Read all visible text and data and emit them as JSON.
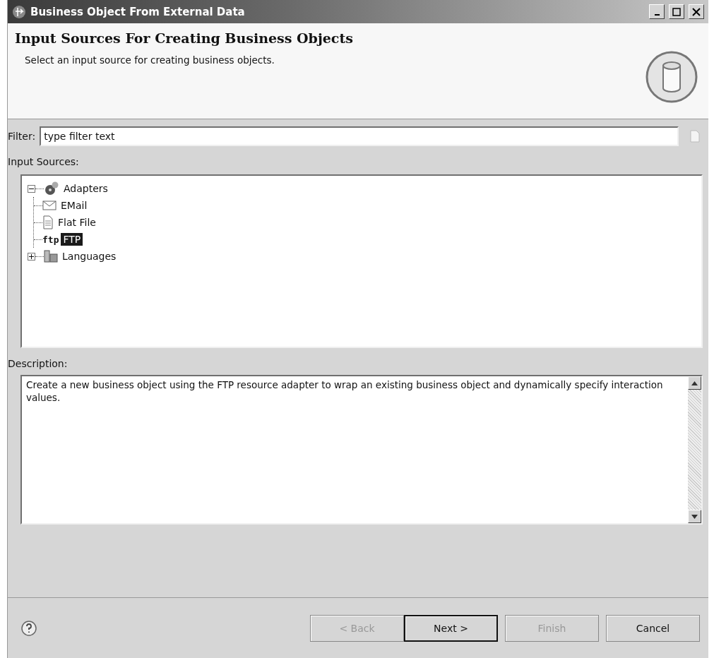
{
  "window": {
    "title": "Business Object From External Data"
  },
  "header": {
    "title": "Input Sources For Creating Business Objects",
    "subtitle": "Select an input source for creating business objects."
  },
  "filter": {
    "label": "Filter:",
    "placeholder": "type filter text"
  },
  "tree": {
    "label": "Input Sources:",
    "items": [
      {
        "label": "Adapters",
        "kind": "adapters",
        "expanded": true,
        "selected": false,
        "children": [
          {
            "label": "EMail",
            "kind": "email",
            "selected": false
          },
          {
            "label": "Flat File",
            "kind": "file",
            "selected": false
          },
          {
            "label": "FTP",
            "kind": "ftp",
            "icon_text": "ftp",
            "selected": true
          }
        ]
      },
      {
        "label": "Languages",
        "kind": "languages",
        "expanded": false,
        "selected": false
      }
    ]
  },
  "description": {
    "label": "Description:",
    "text": "Create a new business object using the FTP resource adapter to wrap an existing business object and dynamically specify interaction values."
  },
  "buttons": [
    {
      "label": "< Back",
      "disabled": true,
      "default": false
    },
    {
      "label": "Next >",
      "disabled": false,
      "default": true
    },
    {
      "label": "Finish",
      "disabled": true,
      "default": false
    },
    {
      "label": "Cancel",
      "disabled": false,
      "default": false
    }
  ]
}
